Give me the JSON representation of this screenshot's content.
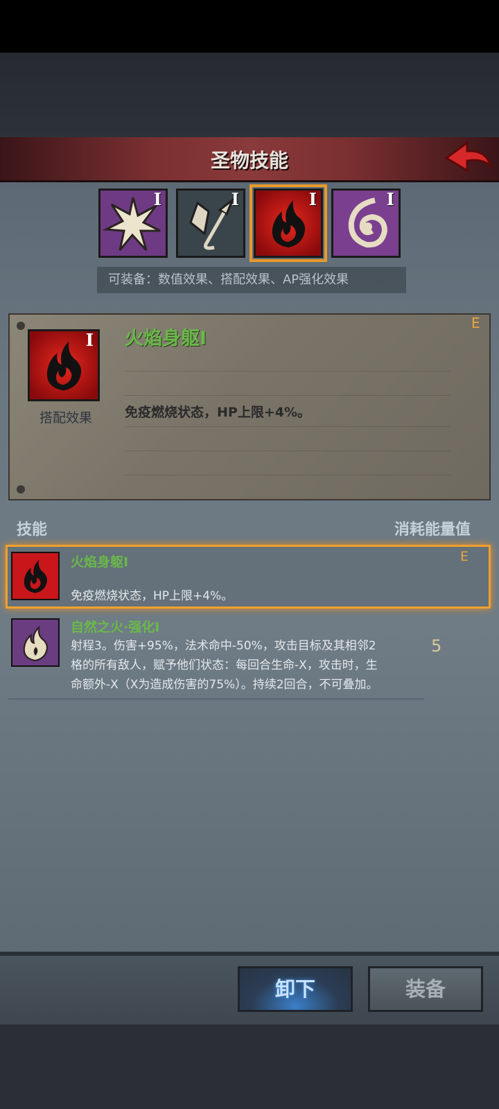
{
  "header": {
    "title": "圣物技能"
  },
  "relic_tabs": [
    {
      "roman": "I"
    },
    {
      "roman": "I"
    },
    {
      "roman": "I"
    },
    {
      "roman": "I"
    }
  ],
  "equip_note": "可装备：数值效果、搭配效果、AP强化效果",
  "detail": {
    "name": "火焰身躯I",
    "roman": "I",
    "type": "搭配效果",
    "description": "免疫燃烧状态，HP上限+4%。",
    "grade": "E"
  },
  "columns": {
    "skill": "技能",
    "cost": "消耗能量值"
  },
  "skills": [
    {
      "name": "火焰身躯I",
      "desc_lines": [
        "免疫燃烧状态，HP上限+4%。"
      ],
      "grade": "E",
      "cost": ""
    },
    {
      "name": "自然之火·强化I",
      "desc_lines": [
        "射程3。伤害+95%，法术命中-50%，攻击目标及其相邻2",
        "格的所有敌人，赋予他们状态：每回合生命-X，攻击时，生",
        "命额外-X（X为造成伤害的75%）。持续2回合，不可叠加。"
      ],
      "grade": "",
      "cost": "5"
    }
  ],
  "buttons": {
    "unequip": "卸下",
    "equip": "装备"
  },
  "icons": [
    "back-arrow-icon",
    "burst-icon",
    "crystal-spear-icon",
    "flame-icon",
    "swirl-icon",
    "nature-flame-icon"
  ],
  "colors": {
    "accent": "#e89a2a",
    "skill_name": "#6ab84a",
    "grade": "#e8a63a"
  }
}
